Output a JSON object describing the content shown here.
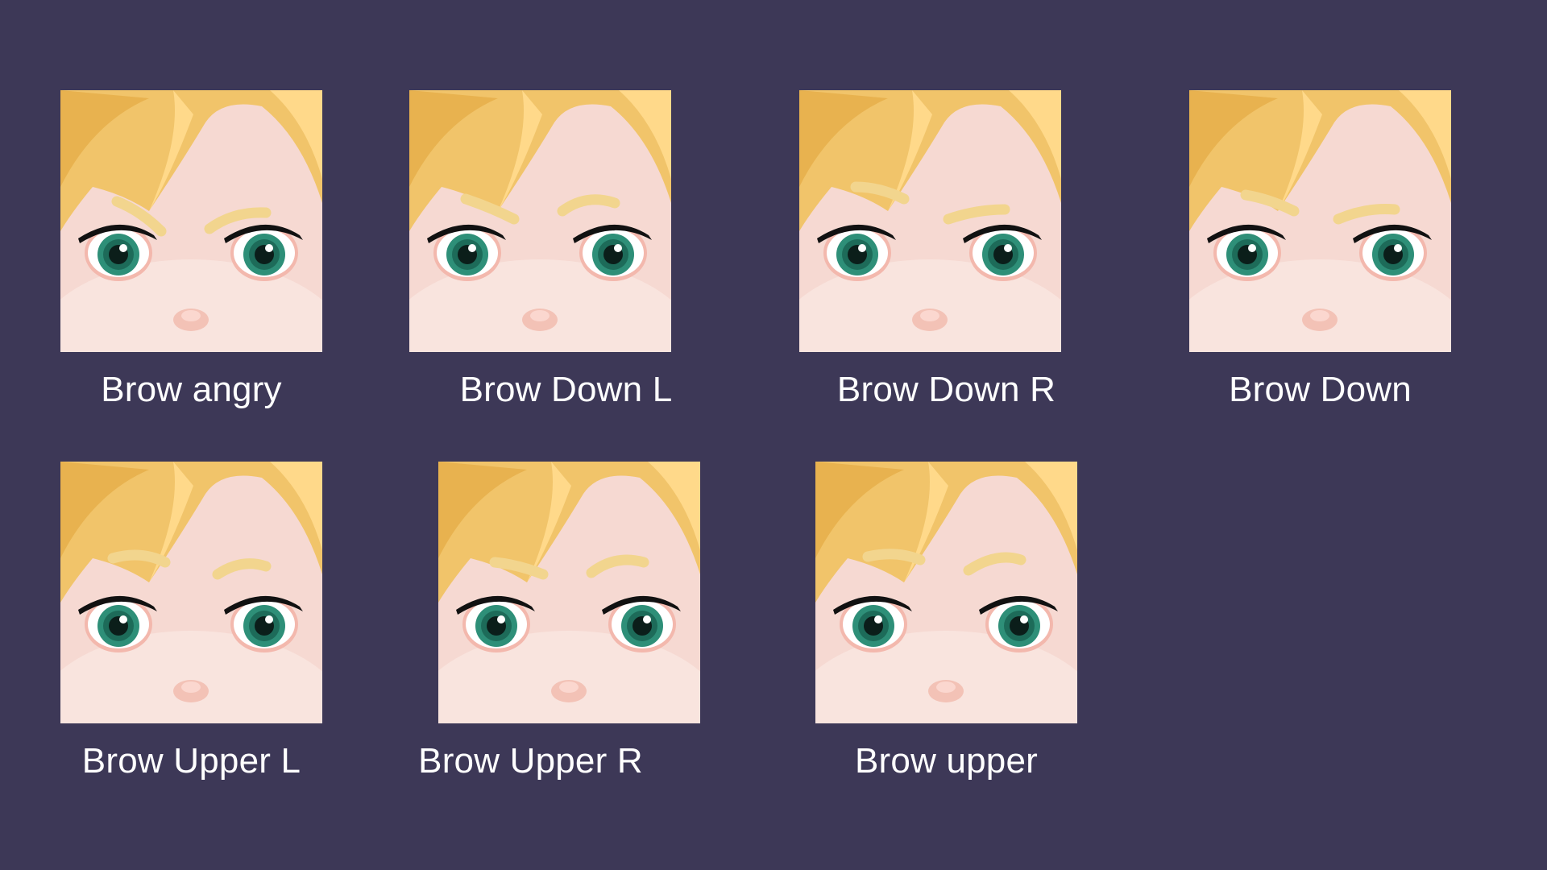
{
  "background_color": "#3d3857",
  "tiles": [
    {
      "label": "Brow angry",
      "variant": "angry"
    },
    {
      "label": "Brow Down L",
      "variant": "down-l"
    },
    {
      "label": "Brow Down R",
      "variant": "down-r"
    },
    {
      "label": "Brow Down",
      "variant": "down"
    },
    {
      "label": "Brow Upper L",
      "variant": "upper-l"
    },
    {
      "label": "Brow Upper R",
      "variant": "upper-r"
    },
    {
      "label": "Brow upper",
      "variant": "upper"
    }
  ],
  "colors": {
    "skin": "#f6d9d2",
    "hair": "#f1c46a",
    "brow": "#f2d58e",
    "iris": "#2e8f78",
    "lash": "#111111"
  }
}
